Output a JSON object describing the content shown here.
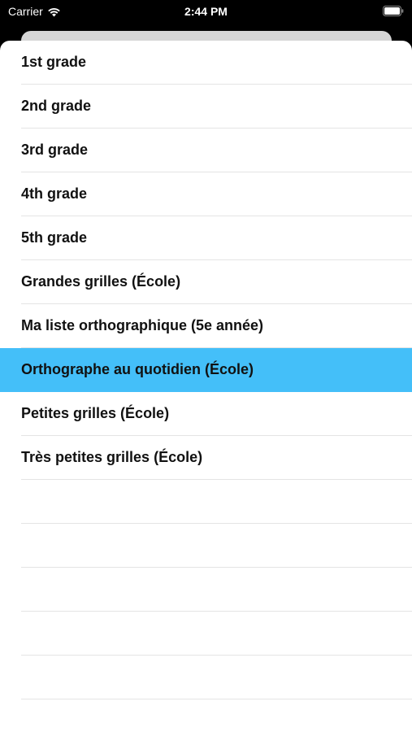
{
  "status_bar": {
    "carrier": "Carrier",
    "time": "2:44 PM"
  },
  "list": {
    "items": [
      {
        "label": "1st grade"
      },
      {
        "label": "2nd grade"
      },
      {
        "label": "3rd grade"
      },
      {
        "label": "4th grade"
      },
      {
        "label": "5th grade"
      },
      {
        "label": "Grandes grilles (École)"
      },
      {
        "label": "Ma liste orthographique (5e année)"
      },
      {
        "label": "Orthographe au quotidien (École)",
        "selected": true
      },
      {
        "label": "Petites grilles (École)"
      },
      {
        "label": "Très petites grilles (École)"
      }
    ],
    "selected_color": "#44bff9"
  }
}
